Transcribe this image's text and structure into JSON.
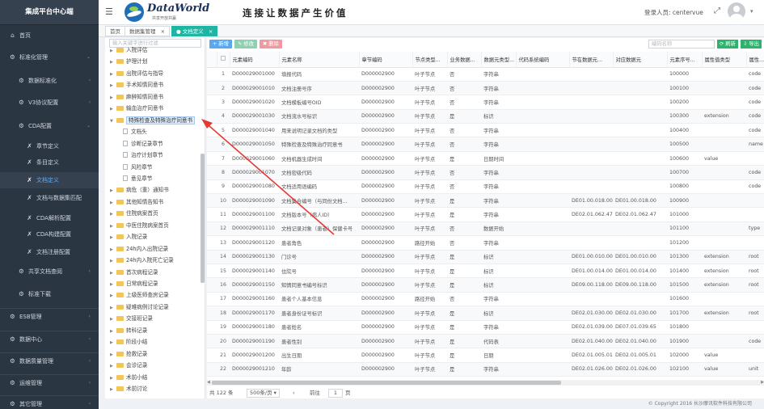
{
  "sidebar": {
    "brand": "集成平台中心端",
    "items": [
      {
        "label": "首页",
        "icon": "home-icon",
        "glyph": "⌂",
        "level": 0,
        "arrow": ""
      },
      {
        "label": "标准化管理",
        "icon": "gear-icon",
        "glyph": "⚙",
        "level": 0,
        "arrow": "⌄"
      },
      {
        "label": "数据标准化",
        "icon": "gear-icon",
        "glyph": "⚙",
        "level": 1,
        "arrow": "‹"
      },
      {
        "label": "V3协议配置",
        "icon": "gear-icon",
        "glyph": "⚙",
        "level": 1,
        "arrow": "‹"
      },
      {
        "label": "CDA配置",
        "icon": "gear-icon",
        "glyph": "⚙",
        "level": 1,
        "arrow": "⌄"
      },
      {
        "label": "章节定义",
        "icon": "tools-icon",
        "glyph": "✗",
        "level": 2,
        "arrow": ""
      },
      {
        "label": "条目定义",
        "icon": "tools-icon",
        "glyph": "✗",
        "level": 2,
        "arrow": ""
      },
      {
        "label": "文档定义",
        "icon": "tools-icon",
        "glyph": "✗",
        "level": 2,
        "arrow": ""
      },
      {
        "label": "文档与数据集匹配",
        "icon": "tools-icon",
        "glyph": "✗",
        "level": 2,
        "arrow": ""
      },
      {
        "label": "CDA解析配置",
        "icon": "tools-icon",
        "glyph": "✗",
        "level": 2,
        "arrow": ""
      },
      {
        "label": "CDA构建配置",
        "icon": "tools-icon",
        "glyph": "✗",
        "level": 2,
        "arrow": ""
      },
      {
        "label": "文档注册配置",
        "icon": "tools-icon",
        "glyph": "✗",
        "level": 2,
        "arrow": ""
      },
      {
        "label": "共享文档查阅",
        "icon": "gear-icon",
        "glyph": "⚙",
        "level": 1,
        "arrow": "‹"
      },
      {
        "label": "标准下载",
        "icon": "gear-icon",
        "glyph": "⚙",
        "level": 1,
        "arrow": ""
      },
      {
        "label": "ESB管理",
        "icon": "gear-icon",
        "glyph": "⚙",
        "level": 0,
        "arrow": "‹"
      },
      {
        "label": "数据中心",
        "icon": "gear-icon",
        "glyph": "⚙",
        "level": 0,
        "arrow": "‹"
      },
      {
        "label": "数据质量管理",
        "icon": "gear-icon",
        "glyph": "⚙",
        "level": 0,
        "arrow": "‹"
      },
      {
        "label": "运维管理",
        "icon": "gear-icon",
        "glyph": "⚙",
        "level": 0,
        "arrow": "‹"
      },
      {
        "label": "其它管理",
        "icon": "gear-icon",
        "glyph": "⚙",
        "level": 0,
        "arrow": "‹"
      }
    ]
  },
  "header": {
    "logo_name": "DataWorld",
    "logo_sub": "共享开放共赢",
    "slogan": "连接让数据产生价值",
    "login_label": "登录人员:",
    "login_user": "centervue"
  },
  "tabs": [
    {
      "label": "首页"
    },
    {
      "label": "数据集管理"
    },
    {
      "label": "文档定义"
    }
  ],
  "tree": {
    "search_placeholder": "输入关键字进行过滤",
    "nodes": [
      {
        "label": "入院评估",
        "level": 0,
        "type": "folder",
        "open": false
      },
      {
        "label": "护理计划",
        "level": 0,
        "type": "folder",
        "open": false
      },
      {
        "label": "出院评估与指导",
        "level": 0,
        "type": "folder",
        "open": false
      },
      {
        "label": "手术知情同意书",
        "level": 0,
        "type": "folder",
        "open": false
      },
      {
        "label": "麻醉知情同意书",
        "level": 0,
        "type": "folder",
        "open": false
      },
      {
        "label": "输血治疗同意书",
        "level": 0,
        "type": "folder",
        "open": false
      },
      {
        "label": "特殊检查及特殊治疗同意书",
        "level": 0,
        "type": "folder",
        "open": true,
        "selected": true
      },
      {
        "label": "文档头",
        "level": 1,
        "type": "doc"
      },
      {
        "label": "诊断记录章节",
        "level": 1,
        "type": "doc"
      },
      {
        "label": "治疗计划章节",
        "level": 1,
        "type": "doc"
      },
      {
        "label": "风险章节",
        "level": 1,
        "type": "doc"
      },
      {
        "label": "意见章节",
        "level": 1,
        "type": "doc"
      },
      {
        "label": "病危（重）通知书",
        "level": 0,
        "type": "folder",
        "open": false
      },
      {
        "label": "其他知情告知书",
        "level": 0,
        "type": "folder",
        "open": false
      },
      {
        "label": "住院病案首页",
        "level": 0,
        "type": "folder",
        "open": false
      },
      {
        "label": "中医住院病案首页",
        "level": 0,
        "type": "folder",
        "open": false
      },
      {
        "label": "入院记录",
        "level": 0,
        "type": "folder",
        "open": false
      },
      {
        "label": "24h内入出院记录",
        "level": 0,
        "type": "folder",
        "open": false
      },
      {
        "label": "24h内入院死亡记录",
        "level": 0,
        "type": "folder",
        "open": false
      },
      {
        "label": "首次病程记录",
        "level": 0,
        "type": "folder",
        "open": false
      },
      {
        "label": "日常病程记录",
        "level": 0,
        "type": "folder",
        "open": false
      },
      {
        "label": "上级医师查房记录",
        "level": 0,
        "type": "folder",
        "open": false
      },
      {
        "label": "疑难病例讨论记录",
        "level": 0,
        "type": "folder",
        "open": false
      },
      {
        "label": "交接班记录",
        "level": 0,
        "type": "folder",
        "open": false
      },
      {
        "label": "转科记录",
        "level": 0,
        "type": "folder",
        "open": false
      },
      {
        "label": "阶段小结",
        "level": 0,
        "type": "folder",
        "open": false
      },
      {
        "label": "抢救记录",
        "level": 0,
        "type": "folder",
        "open": false
      },
      {
        "label": "会诊记录",
        "level": 0,
        "type": "folder",
        "open": false
      },
      {
        "label": "术前小结",
        "level": 0,
        "type": "folder",
        "open": false
      },
      {
        "label": "术前讨论",
        "level": 0,
        "type": "folder",
        "open": false
      }
    ]
  },
  "toolbar": {
    "add": "+ 新增",
    "edit": "✎ 修改",
    "delete": "✖ 删除",
    "name_placeholder": "编码名称",
    "refresh": "⟳ 刷新",
    "export": "⇩ 导出"
  },
  "table": {
    "columns": [
      "",
      "",
      "元素编码",
      "元素名称",
      "章节编码",
      "节点类型...",
      "业务数据...",
      "数据元类型...",
      "代码系统编码",
      "节在数据元...",
      "对应数据元",
      "元素序号...",
      "属性值类型",
      "属性..."
    ],
    "rows": [
      [
        "1",
        "D000029001000",
        "填报代码",
        "D000002900",
        "叶子节点",
        "否",
        "字符串",
        "",
        "",
        "",
        "100000",
        "",
        "code"
      ],
      [
        "2",
        "D000029001010",
        "文档注册号序",
        "D000002900",
        "叶子节点",
        "否",
        "字符串",
        "",
        "",
        "",
        "100100",
        "",
        "code"
      ],
      [
        "3",
        "D000029001020",
        "文档模板编号OID",
        "D000002900",
        "叶子节点",
        "否",
        "字符串",
        "",
        "",
        "",
        "100200",
        "",
        "code"
      ],
      [
        "4",
        "D000029001030",
        "文档流水号标识",
        "D000002900",
        "叶子节点",
        "是",
        "标识",
        "",
        "",
        "",
        "100300",
        "extension",
        "code"
      ],
      [
        "5",
        "D000029001040",
        "用来说明记录文档的类型",
        "D000002900",
        "叶子节点",
        "否",
        "字符串",
        "",
        "",
        "",
        "100400",
        "",
        "code"
      ],
      [
        "6",
        "D000029001050",
        "特殊检查及特殊治疗同意书",
        "D000002900",
        "叶子节点",
        "否",
        "字符串",
        "",
        "",
        "",
        "100500",
        "",
        "name"
      ],
      [
        "7",
        "D000029001060",
        "文档机器生成时间",
        "D000002900",
        "叶子节点",
        "是",
        "日期时间",
        "",
        "",
        "",
        "100600",
        "value",
        ""
      ],
      [
        "8",
        "D000029001070",
        "文档密级代码",
        "D000002900",
        "叶子节点",
        "否",
        "字符串",
        "",
        "",
        "",
        "100700",
        "",
        "code"
      ],
      [
        "9",
        "D000029001080",
        "文档适用语编码",
        "D000002900",
        "叶子节点",
        "否",
        "字符串",
        "",
        "",
        "",
        "100800",
        "",
        "code"
      ],
      [
        "10",
        "D000029001090",
        "文档集合编号（与同份文档...",
        "D000002900",
        "叶子节点",
        "是",
        "字符串",
        "",
        "DE01.00.018.00",
        "DE01.00.018.00",
        "100900",
        "",
        ""
      ],
      [
        "11",
        "D000029001100",
        "文档版本号（病人ID）",
        "D000002900",
        "叶子节点",
        "是",
        "字符串",
        "",
        "DE02.01.062.47",
        "DE02.01.062.47",
        "101000",
        "",
        ""
      ],
      [
        "12",
        "D000029001110",
        "文档记录对象（患者）保健卡号",
        "D000002900",
        "叶子节点",
        "否",
        "数据开始",
        "",
        "",
        "",
        "101100",
        "",
        "type"
      ],
      [
        "13",
        "D000029001120",
        "患者角色",
        "D000002900",
        "路径开始",
        "否",
        "字符串",
        "",
        "",
        "",
        "101200",
        "",
        ""
      ],
      [
        "14",
        "D000029001130",
        "门诊号",
        "D000002900",
        "叶子节点",
        "是",
        "标识",
        "",
        "DE01.00.010.00",
        "DE01.00.010.00",
        "101300",
        "extension",
        "root"
      ],
      [
        "15",
        "D000029001140",
        "住院号",
        "D000002900",
        "叶子节点",
        "是",
        "标识",
        "",
        "DE01.00.014.00",
        "DE01.00.014.00",
        "101400",
        "extension",
        "root"
      ],
      [
        "16",
        "D000029001150",
        "知情同意书编号标识",
        "D000002900",
        "叶子节点",
        "是",
        "标识",
        "",
        "DE09.00.118.00",
        "DE09.00.118.00",
        "101500",
        "extension",
        "root"
      ],
      [
        "17",
        "D000029001160",
        "患者个人基本信息",
        "D000002900",
        "路径开始",
        "否",
        "字符串",
        "",
        "",
        "",
        "101600",
        "",
        ""
      ],
      [
        "18",
        "D000029001170",
        "患者身份证号标识",
        "D000002900",
        "叶子节点",
        "是",
        "标识",
        "",
        "DE02.01.030.00",
        "DE02.01.030.00",
        "101700",
        "extension",
        "root"
      ],
      [
        "19",
        "D000029001180",
        "患者姓名",
        "D000002900",
        "叶子节点",
        "是",
        "字符串",
        "",
        "DE02.01.039.00",
        "DE07.01.039.65",
        "101800",
        "",
        ""
      ],
      [
        "20",
        "D000029001190",
        "患者性别",
        "D000002900",
        "叶子节点",
        "是",
        "代码表",
        "",
        "DE02.01.040.00",
        "DE02.01.040.00",
        "101900",
        "",
        "code"
      ],
      [
        "21",
        "D000029001200",
        "出生日期",
        "D000002900",
        "叶子节点",
        "是",
        "日期",
        "",
        "DE02.01.005.01",
        "DE02.01.005.01",
        "102000",
        "value",
        ""
      ],
      [
        "22",
        "D000029001210",
        "年龄",
        "D000002900",
        "叶子节点",
        "是",
        "字符串",
        "",
        "DE02.01.026.00",
        "DE02.01.026.00",
        "102100",
        "value",
        "unit"
      ]
    ]
  },
  "pager": {
    "total": "共 122 条",
    "page_size": "500条/页",
    "prev": "前往",
    "page": "1",
    "page_unit": "页"
  },
  "footer": "© Copyright 2016 长沙摩讯软件科技有限公司",
  "colors": {
    "accent": "#1fb5a2",
    "sidebar": "#2b3643",
    "annotation_arrow": "#e53935"
  }
}
